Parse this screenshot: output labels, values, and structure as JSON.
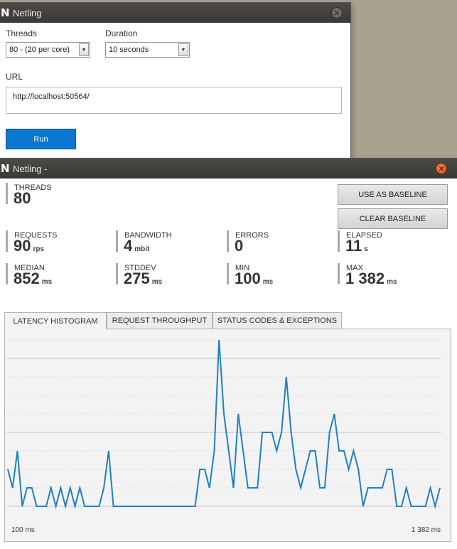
{
  "setup_window": {
    "title": "Netling",
    "threads_label": "Threads",
    "threads_value": "80 - (20 per core)",
    "duration_label": "Duration",
    "duration_value": "10 seconds",
    "url_label": "URL",
    "url_value": "http://localhost:50564/",
    "run_label": "Run"
  },
  "results_window": {
    "title": "Netling -",
    "threads": {
      "label": "THREADS",
      "value": "80",
      "unit": ""
    },
    "buttons": {
      "baseline": "USE AS BASELINE",
      "clear": "CLEAR BASELINE"
    },
    "stats": {
      "requests": {
        "label": "REQUESTS",
        "value": "90",
        "unit": "rps"
      },
      "bandwidth": {
        "label": "BANDWIDTH",
        "value": "4",
        "unit": "mbit"
      },
      "errors": {
        "label": "ERRORS",
        "value": "0",
        "unit": ""
      },
      "elapsed": {
        "label": "ELAPSED",
        "value": "11",
        "unit": "s"
      },
      "median": {
        "label": "MEDIAN",
        "value": "852",
        "unit": "ms"
      },
      "stddev": {
        "label": "STDDEV",
        "value": "275",
        "unit": "ms"
      },
      "min": {
        "label": "MIN",
        "value": "100",
        "unit": "ms"
      },
      "max": {
        "label": "MAX",
        "value": "1 382",
        "unit": "ms"
      }
    },
    "tabs": [
      "LATENCY HISTOGRAM",
      "REQUEST THROUGHPUT",
      "STATUS CODES & EXCEPTIONS"
    ],
    "active_tab": 0
  },
  "colors": {
    "line": "#1e7fc7",
    "run_button": "#0a78d0",
    "close_orange": "#e05a22"
  },
  "icons": [
    "netling-app-icon",
    "close-icon"
  ],
  "chart_data": {
    "type": "line",
    "title": "",
    "xlabel": "",
    "ylabel": "",
    "x_start_label": "100 ms",
    "x_end_label": "1 382 ms",
    "ylim": [
      0,
      9
    ],
    "grid": true,
    "values": [
      2,
      1,
      3,
      0,
      1,
      1,
      0,
      0,
      0,
      1,
      0,
      1,
      0,
      1,
      0,
      1,
      0,
      0,
      0,
      0,
      1,
      3,
      0,
      0,
      0,
      0,
      0,
      0,
      0,
      0,
      0,
      0,
      0,
      0,
      0,
      0,
      0,
      0,
      0,
      0,
      2,
      2,
      1,
      3,
      9,
      5,
      3,
      1,
      5,
      3,
      1,
      1,
      1,
      4,
      4,
      4,
      3,
      4,
      7,
      4,
      2,
      1,
      2,
      3,
      3,
      1,
      1,
      4,
      5,
      3,
      3,
      2,
      3,
      2,
      0,
      1,
      1,
      1,
      1,
      2,
      2,
      0,
      0,
      1,
      0,
      0,
      0,
      0,
      1,
      0,
      1
    ]
  }
}
